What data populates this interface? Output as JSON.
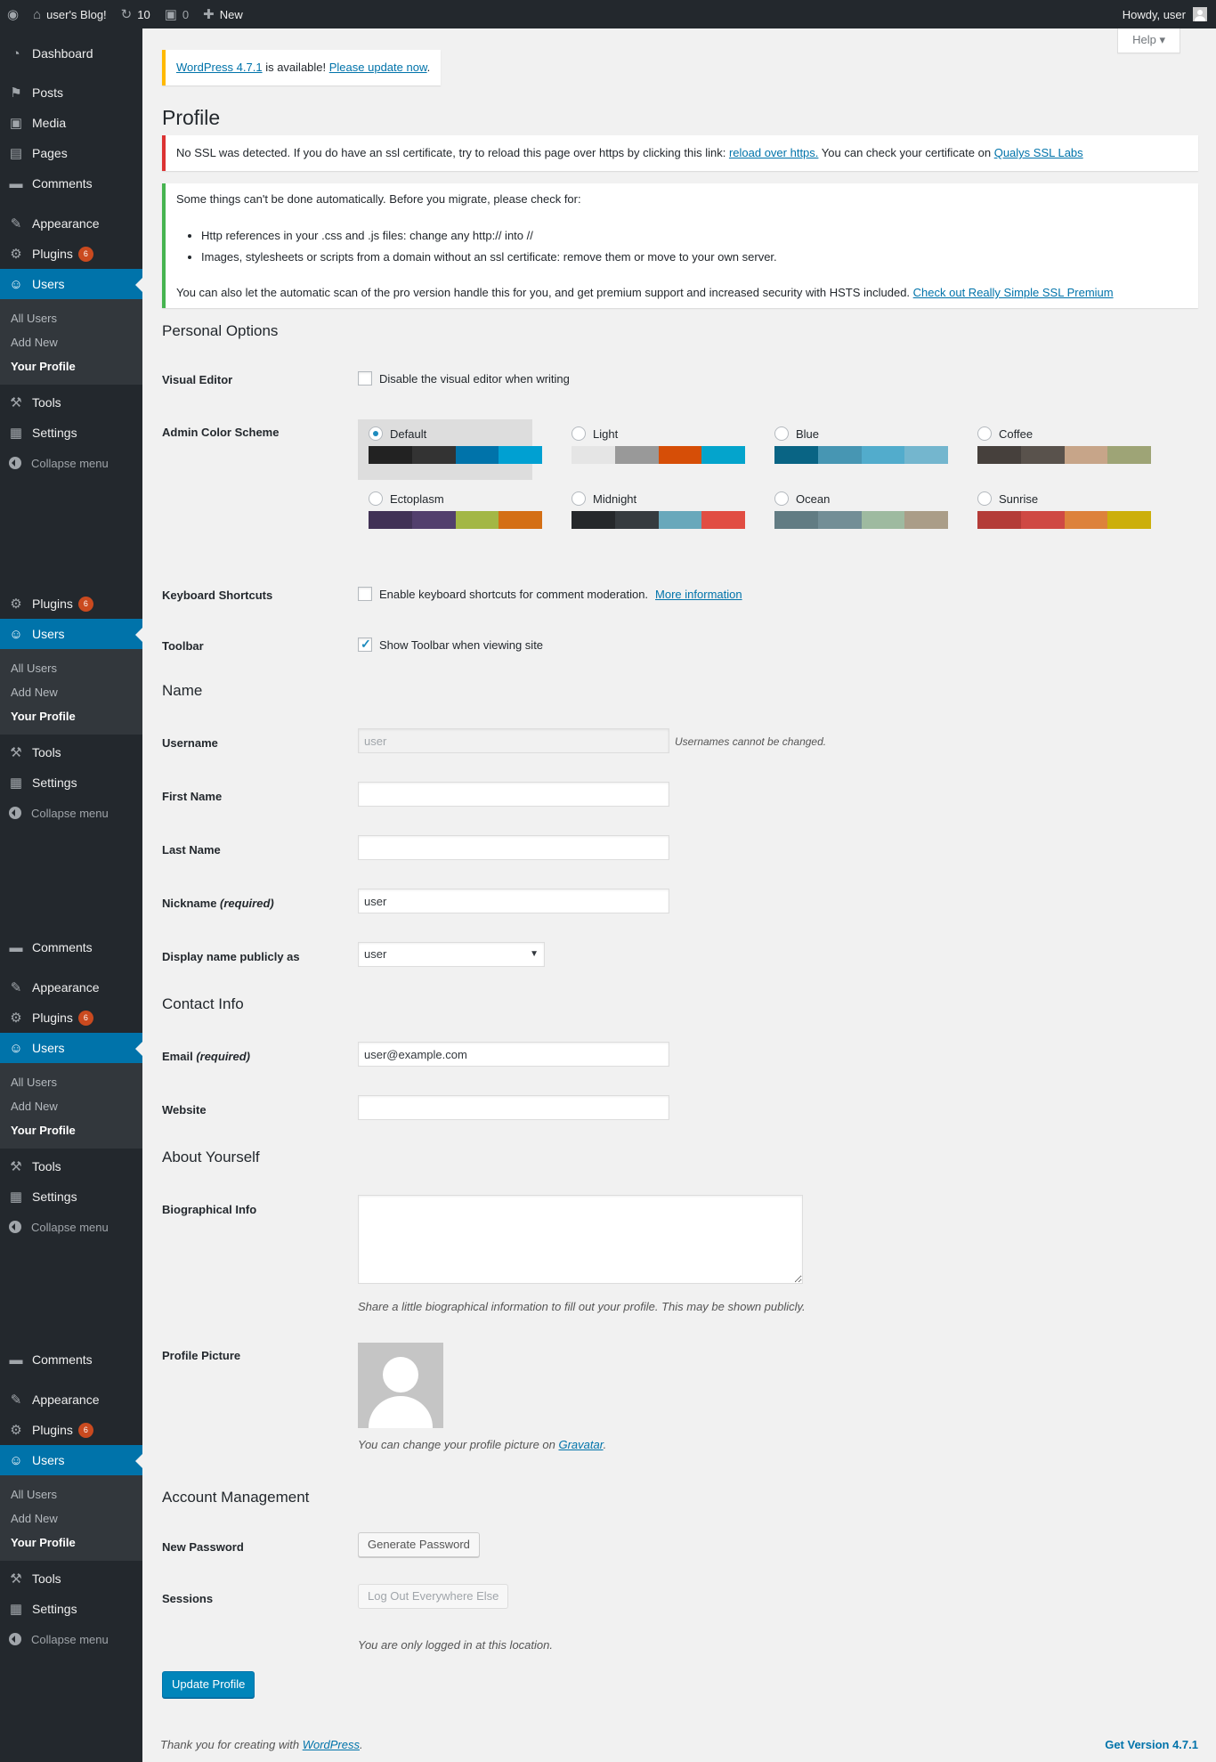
{
  "admin_bar": {
    "site_name": "user's Blog!",
    "updates_count": "10",
    "comments_count": "0",
    "new_label": "New",
    "howdy": "Howdy, user"
  },
  "sidebar": {
    "dashboard": "Dashboard",
    "posts": "Posts",
    "media": "Media",
    "pages": "Pages",
    "comments": "Comments",
    "appearance": "Appearance",
    "plugins": "Plugins",
    "plugins_badge": "6",
    "users": "Users",
    "all_users": "All Users",
    "add_new": "Add New",
    "your_profile": "Your Profile",
    "tools": "Tools",
    "settings": "Settings",
    "collapse": "Collapse menu"
  },
  "help_label": "Help",
  "update_notice": {
    "link1": "WordPress 4.7.1",
    "middle": " is available! ",
    "link2": "Please update now",
    "end": "."
  },
  "page_title": "Profile",
  "ssl_error": {
    "text": "No SSL was detected. If you do have an ssl certificate, try to reload this page over https by clicking this link: ",
    "link1": "reload over https.",
    "text2": " You can check your certificate on ",
    "link2": "Qualys SSL Labs"
  },
  "ssl_info": {
    "intro": "Some things can't be done automatically. Before you migrate, please check for:",
    "bullet1": "Http references in your .css and .js files: change any http:// into //",
    "bullet2": "Images, stylesheets or scripts from a domain without an ssl certificate: remove them or move to your own server.",
    "footer": "You can also let the automatic scan of the pro version handle this for you, and get premium support and increased security with HSTS included. ",
    "link": "Check out Really Simple SSL Premium"
  },
  "personal_options": {
    "heading": "Personal Options",
    "visual_editor_label": "Visual Editor",
    "visual_editor_text": "Disable the visual editor when writing",
    "color_scheme_label": "Admin Color Scheme",
    "schemes": [
      {
        "name": "Default",
        "colors": [
          "#222",
          "#333",
          "#0073aa",
          "#00a0d2"
        ],
        "selected": true
      },
      {
        "name": "Light",
        "colors": [
          "#e5e5e5",
          "#999",
          "#d64e07",
          "#04a4cc"
        ],
        "selected": false
      },
      {
        "name": "Blue",
        "colors": [
          "#096484",
          "#4796b3",
          "#52accc",
          "#74B6CE"
        ],
        "selected": false
      },
      {
        "name": "Coffee",
        "colors": [
          "#46403c",
          "#59524c",
          "#c7a589",
          "#9ea476"
        ],
        "selected": false
      },
      {
        "name": "Ectoplasm",
        "colors": [
          "#413256",
          "#523f6d",
          "#a3b745",
          "#d46f15"
        ],
        "selected": false
      },
      {
        "name": "Midnight",
        "colors": [
          "#25282b",
          "#363b3f",
          "#69a8bb",
          "#e14d43"
        ],
        "selected": false
      },
      {
        "name": "Ocean",
        "colors": [
          "#627c83",
          "#738e96",
          "#9ebaa0",
          "#aa9d88"
        ],
        "selected": false
      },
      {
        "name": "Sunrise",
        "colors": [
          "#b43c38",
          "#cf4944",
          "#dd823b",
          "#ccaf0b"
        ],
        "selected": false
      }
    ],
    "keyboard_label": "Keyboard Shortcuts",
    "keyboard_text": "Enable keyboard shortcuts for comment moderation.",
    "keyboard_link": "More information",
    "toolbar_label": "Toolbar",
    "toolbar_text": "Show Toolbar when viewing site"
  },
  "name_section": {
    "heading": "Name",
    "username_label": "Username",
    "username_value": "user",
    "username_note": "Usernames cannot be changed.",
    "first_name_label": "First Name",
    "first_name_value": "",
    "last_name_label": "Last Name",
    "last_name_value": "",
    "nickname_label": "Nickname",
    "required": "(required)",
    "nickname_value": "user",
    "display_label": "Display name publicly as",
    "display_value": "user"
  },
  "contact": {
    "heading": "Contact Info",
    "email_label": "Email",
    "required": "(required)",
    "email_value": "user@example.com",
    "website_label": "Website",
    "website_value": ""
  },
  "about": {
    "heading": "About Yourself",
    "bio_label": "Biographical Info",
    "bio_desc": "Share a little biographical information to fill out your profile. This may be shown publicly.",
    "picture_label": "Profile Picture",
    "picture_desc": "You can change your profile picture on ",
    "gravatar": "Gravatar",
    "picture_end": "."
  },
  "account": {
    "heading": "Account Management",
    "password_label": "New Password",
    "generate_button": "Generate Password",
    "sessions_label": "Sessions",
    "logout_button": "Log Out Everywhere Else",
    "sessions_desc": "You are only logged in at this location."
  },
  "update_button": "Update Profile",
  "footer": {
    "thanks": "Thank you for creating with ",
    "wp_link": "WordPress",
    "thanks_end": ".",
    "version": "Get Version 4.7.1"
  }
}
